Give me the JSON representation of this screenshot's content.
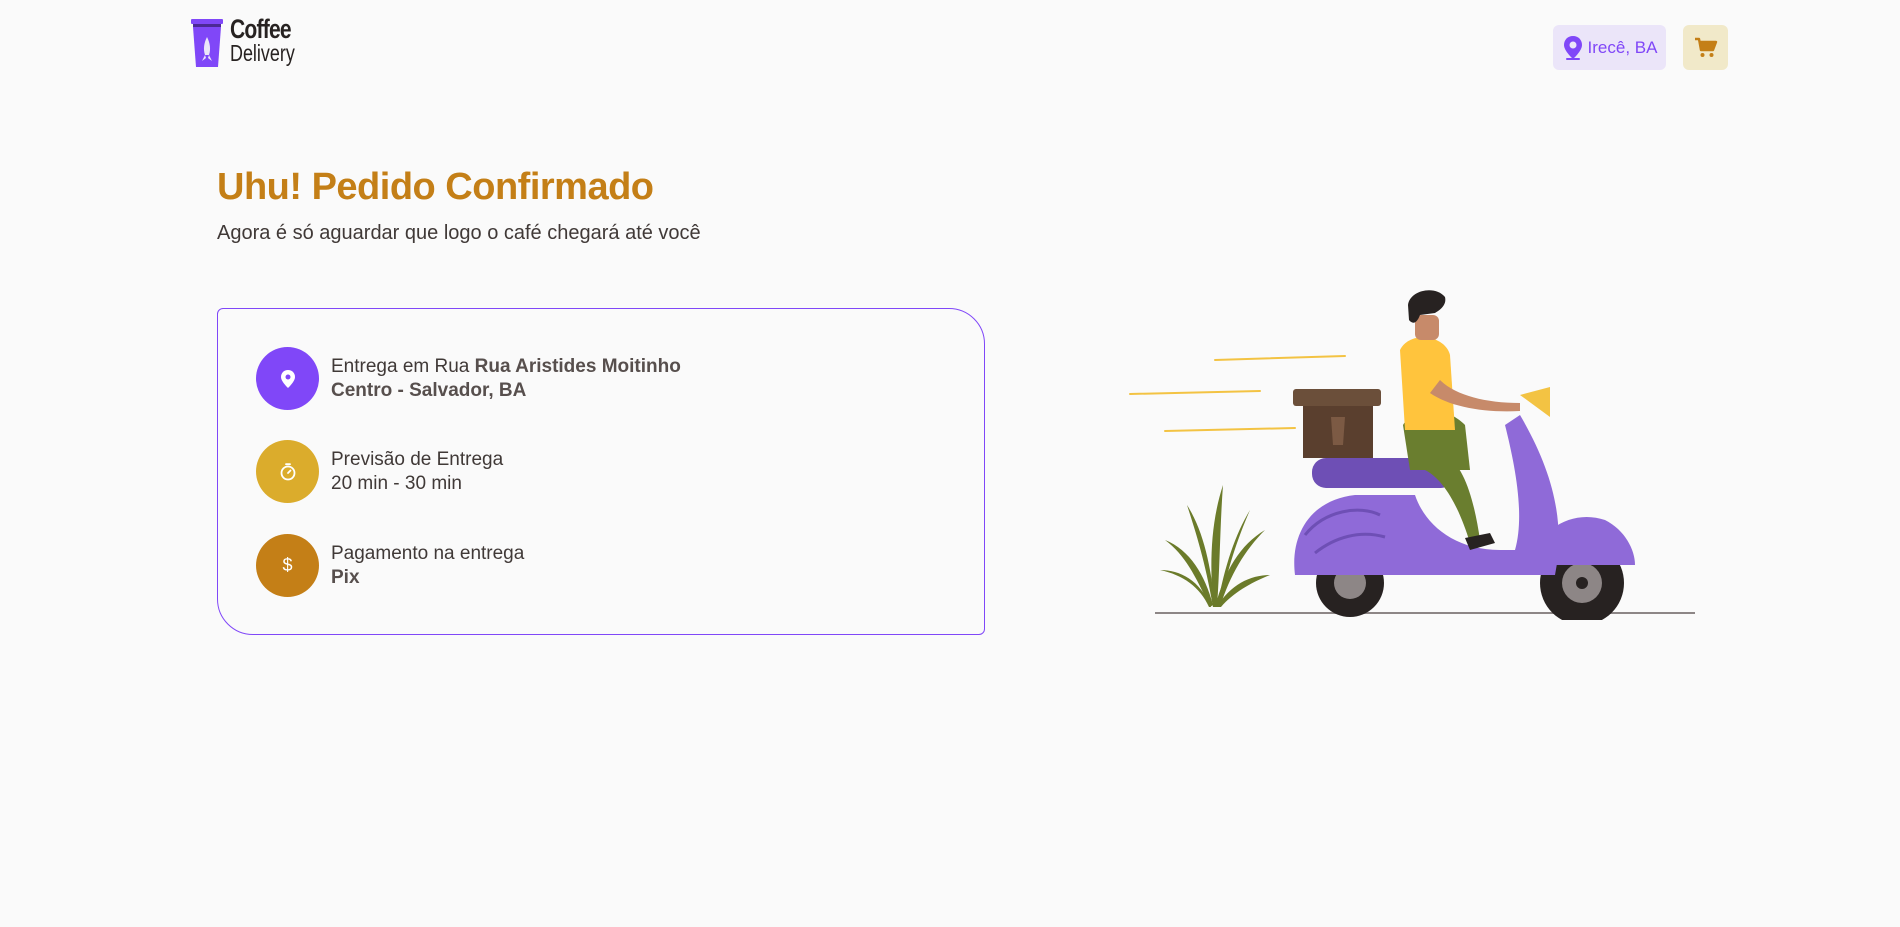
{
  "header": {
    "logo_line1": "Coffee",
    "logo_line2": "Delivery",
    "location": "Irecê, BA"
  },
  "main": {
    "title": "Uhu! Pedido Confirmado",
    "subtitle": "Agora é só aguardar que logo o café chegará até você"
  },
  "order_info": {
    "address_prefix": "Entrega em Rua ",
    "address_street": "Rua Aristides Moitinho",
    "address_city": "Centro - Salvador, BA",
    "forecast_label": "Previsão de Entrega",
    "forecast_value": "20 min - 30 min",
    "payment_label": "Pagamento na entrega",
    "payment_value": "Pix"
  },
  "icons": {
    "location": "map-pin-icon",
    "timer": "timer-icon",
    "payment": "dollar-icon",
    "cart": "cart-icon"
  },
  "colors": {
    "purple": "#8047F8",
    "yellow": "#DBAC2C",
    "yellow_dark": "#C47F17",
    "purple_light": "#EBE5F9",
    "yellow_light": "#F1E9C9"
  }
}
